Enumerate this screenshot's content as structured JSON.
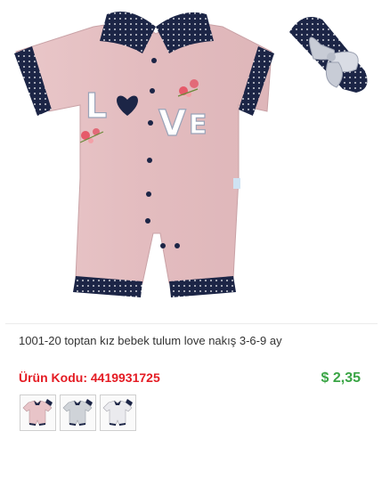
{
  "product": {
    "image_letters": {
      "l": "L",
      "v": "V",
      "e": "E"
    },
    "title": "1001-20 toptan kız bebek tulum love nakış 3-6-9 ay",
    "code_text": "Ürün Kodu: 4419931725",
    "price": "$ 2,35"
  },
  "thumbnails": [
    {
      "name": "pink-romper-thumbnail",
      "body_color": "#e8c4c8"
    },
    {
      "name": "grey-romper-thumbnail",
      "body_color": "#cfd3d8"
    },
    {
      "name": "white-romper-thumbnail",
      "body_color": "#eaeaee"
    }
  ],
  "colors": {
    "body": "#e6c2c4",
    "navy": "#1c2546",
    "code_red": "#e41b23",
    "price_green": "#3aa545"
  }
}
